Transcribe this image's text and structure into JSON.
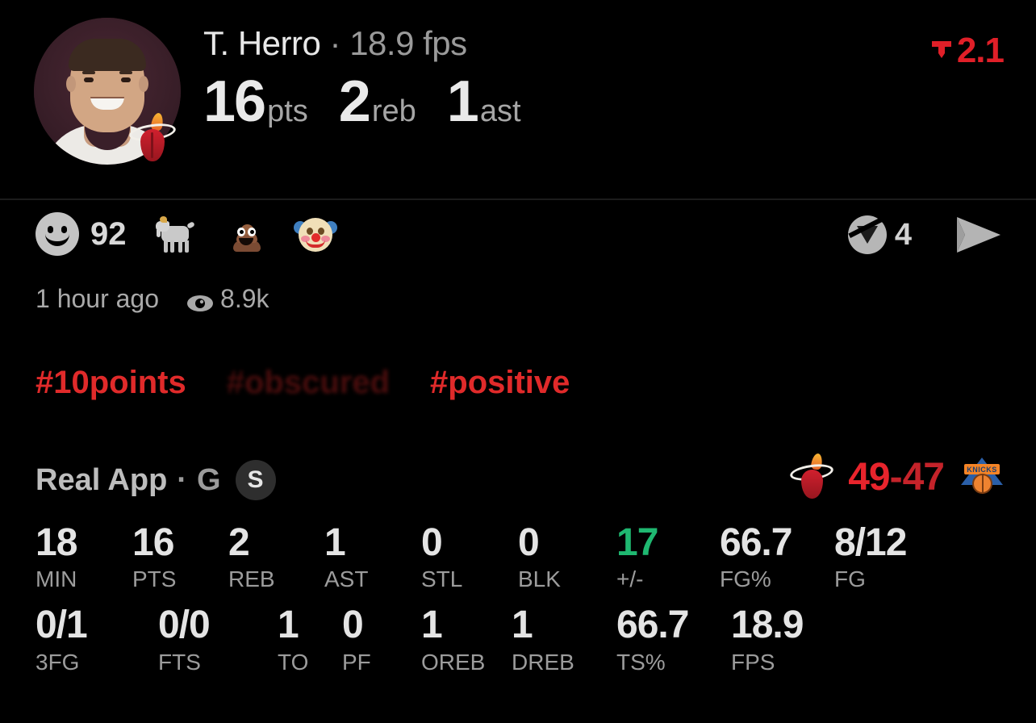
{
  "header": {
    "player_name": "T. Herro",
    "separator": "·",
    "fps": "18.9 fps",
    "avatar_name": "player-headshot",
    "team_badge": "miami-heat-logo",
    "quick_stats": [
      {
        "value": "16",
        "unit": "pts"
      },
      {
        "value": "2",
        "unit": "reb"
      },
      {
        "value": "1",
        "unit": "ast"
      }
    ],
    "trend": {
      "icon": "trend-down-arrow",
      "value": "2.1",
      "color": "#e01f28"
    }
  },
  "reactions": {
    "smiley_icon": "smiley-face-icon",
    "count": "92",
    "emojis": [
      {
        "name": "goat-emoji",
        "glyph": "goat"
      },
      {
        "name": "poop-emoji",
        "glyph": "poop"
      },
      {
        "name": "clown-emoji",
        "glyph": "clown"
      }
    ],
    "comment_icon": "comment-icon",
    "comment_count": "4",
    "share_icon": "send-icon"
  },
  "meta": {
    "time_ago": "1 hour ago",
    "views_icon": "eye-icon",
    "views": "8.9k"
  },
  "hashtags": [
    {
      "text": "#10points",
      "obscured": false
    },
    {
      "text": "#obscured",
      "visible_tail": "e",
      "obscured": true
    },
    {
      "text": "#positive",
      "obscured": false
    }
  ],
  "app_row": {
    "app_name": "Real App",
    "dot": "·",
    "period": "G",
    "badge": "S"
  },
  "score": {
    "home_logo": "miami-heat-logo",
    "home": "49",
    "dash": "-",
    "away": "47",
    "away_logo": "new-york-knicks-logo"
  },
  "stats": {
    "row1": [
      {
        "value": "18",
        "label": "MIN",
        "positive": false
      },
      {
        "value": "16",
        "label": "PTS",
        "positive": false
      },
      {
        "value": "2",
        "label": "REB",
        "positive": false
      },
      {
        "value": "1",
        "label": "AST",
        "positive": false
      },
      {
        "value": "0",
        "label": "STL",
        "positive": false
      },
      {
        "value": "0",
        "label": "BLK",
        "positive": false
      },
      {
        "value": "17",
        "label": "+/-",
        "positive": true
      },
      {
        "value": "66.7",
        "label": "FG%",
        "positive": false
      },
      {
        "value": "8/12",
        "label": "FG",
        "positive": false
      }
    ],
    "row2": [
      {
        "value": "0/1",
        "label": "3FG",
        "positive": false
      },
      {
        "value": "0/0",
        "label": "FTS",
        "positive": false
      },
      {
        "value": "1",
        "label": "TO",
        "positive": false
      },
      {
        "value": "0",
        "label": "PF",
        "positive": false
      },
      {
        "value": "1",
        "label": "OREB",
        "positive": false
      },
      {
        "value": "1",
        "label": "DREB",
        "positive": false
      },
      {
        "value": "66.7",
        "label": "TS%",
        "positive": false
      },
      {
        "value": "18.9",
        "label": "FPS",
        "positive": false
      }
    ]
  },
  "colors": {
    "background": "#000000",
    "accent_red": "#e02a2a",
    "positive_green": "#1fb871",
    "text_primary": "#e4e4e4",
    "text_secondary": "#9c9c9c"
  }
}
